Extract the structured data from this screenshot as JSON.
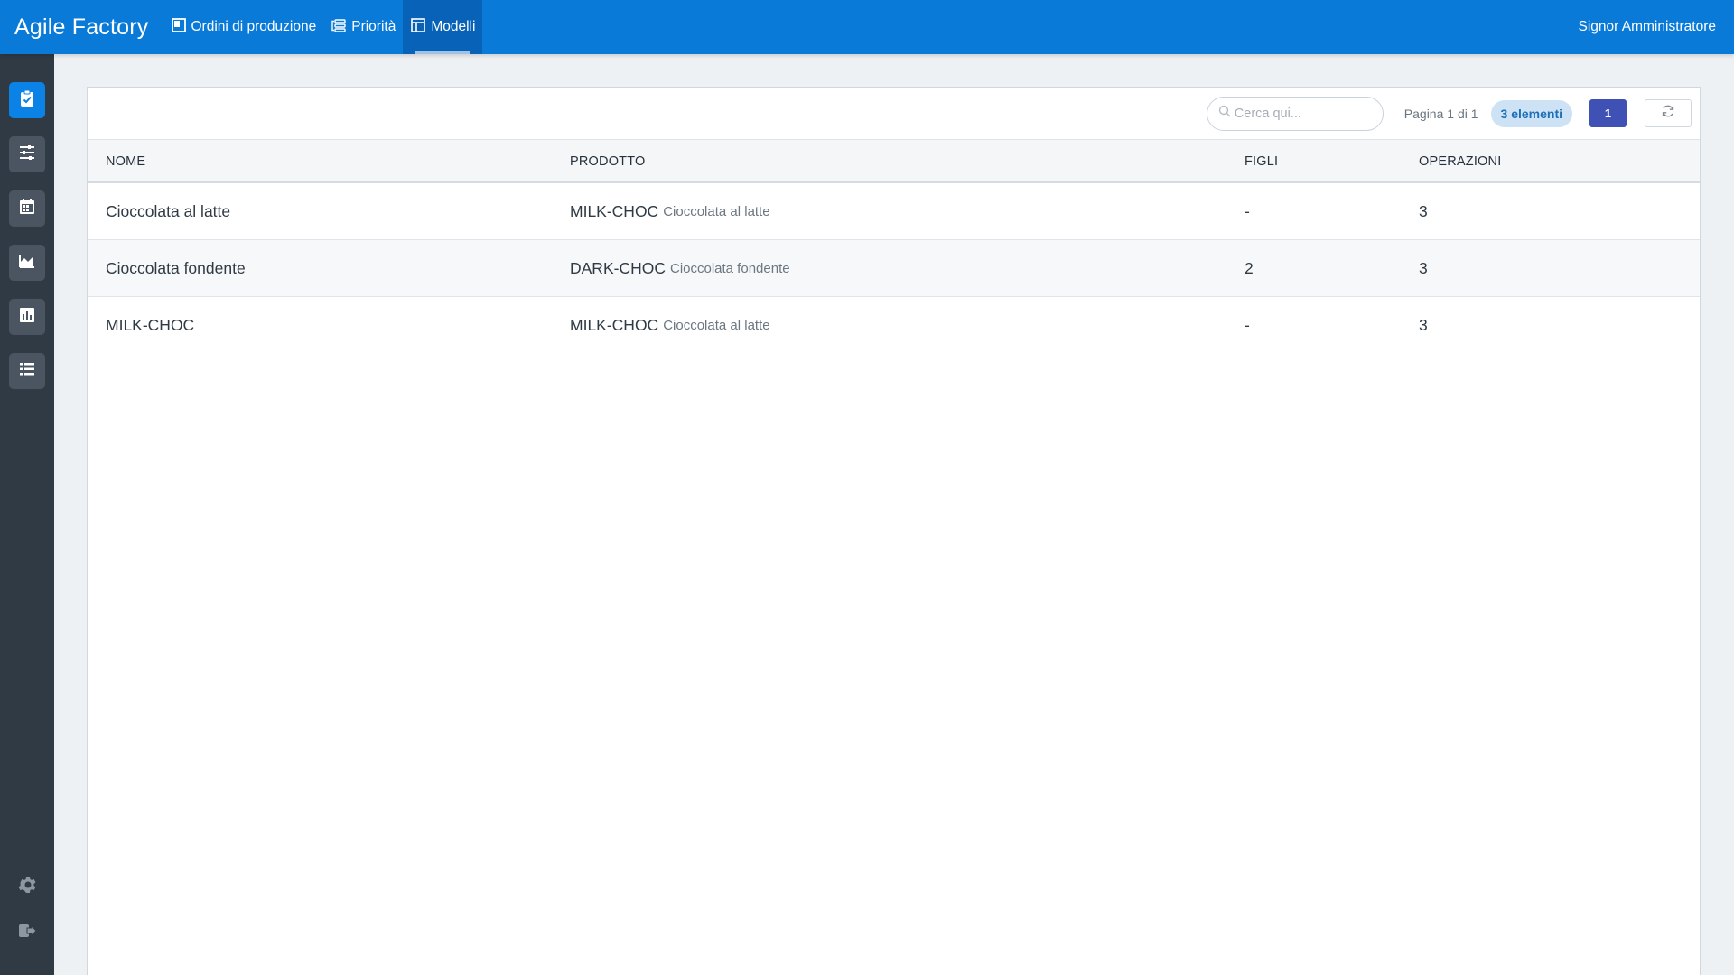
{
  "app": {
    "title": "Agile Factory"
  },
  "nav": [
    {
      "label": "Ordini di produzione",
      "icon": "board-icon",
      "active": false
    },
    {
      "label": "Priorità",
      "icon": "priority-list-icon",
      "active": false
    },
    {
      "label": "Modelli",
      "icon": "layout-template-icon",
      "active": true
    }
  ],
  "user": {
    "name": "Signor Amministratore"
  },
  "sidebar": {
    "items": [
      {
        "icon": "clipboard-check-icon",
        "active": true
      },
      {
        "icon": "sliders-icon",
        "active": false
      },
      {
        "icon": "calendar-icon",
        "active": false
      },
      {
        "icon": "area-chart-icon",
        "active": false
      },
      {
        "icon": "bar-chart-icon",
        "active": false
      },
      {
        "icon": "list-icon",
        "active": false
      }
    ],
    "bottom": [
      {
        "icon": "gear-icon"
      },
      {
        "icon": "logout-icon"
      }
    ]
  },
  "toolbar": {
    "search_placeholder": "Cerca qui...",
    "page_info": "Pagina 1 di 1",
    "count_badge": "3 elementi",
    "current_page": "1"
  },
  "table": {
    "columns": [
      "NOME",
      "PRODOTTO",
      "FIGLI",
      "OPERAZIONI"
    ],
    "rows": [
      {
        "nome": "Cioccolata al latte",
        "prodotto_code": "MILK-CHOC",
        "prodotto_name": "Cioccolata al latte",
        "figli": "-",
        "operazioni": "3"
      },
      {
        "nome": "Cioccolata fondente",
        "prodotto_code": "DARK-CHOC",
        "prodotto_name": "Cioccolata fondente",
        "figli": "2",
        "operazioni": "3"
      },
      {
        "nome": "MILK-CHOC",
        "prodotto_code": "MILK-CHOC",
        "prodotto_name": "Cioccolata al latte",
        "figli": "-",
        "operazioni": "3"
      }
    ]
  },
  "colors": {
    "topbar": "#0a7ad9",
    "sidebar": "#2f3a44",
    "accent": "#0a82e6",
    "page_button": "#3f51b5",
    "badge_bg": "#cde2f5"
  }
}
